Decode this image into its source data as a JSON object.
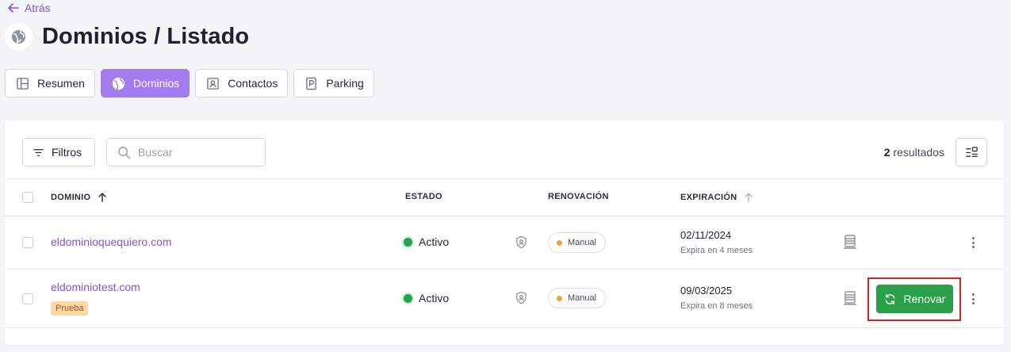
{
  "nav": {
    "back_label": "Atrás"
  },
  "header": {
    "title": "Dominios / Listado",
    "icon": "globe-icon"
  },
  "tabs": [
    {
      "label": "Resumen",
      "icon": "layout-icon",
      "active": false
    },
    {
      "label": "Dominios",
      "icon": "globe-icon",
      "active": true
    },
    {
      "label": "Contactos",
      "icon": "contact-card-icon",
      "active": false
    },
    {
      "label": "Parking",
      "icon": "parking-icon",
      "active": false
    }
  ],
  "toolbar": {
    "filters_label": "Filtros",
    "search_placeholder": "Buscar",
    "search_value": "",
    "results_count": "2",
    "results_label": "resultados"
  },
  "table": {
    "headers": {
      "dominio": "DOMINIO",
      "estado": "ESTADO",
      "renovacion": "RENOVACIÓN",
      "expiracion": "EXPIRACIÓN"
    },
    "rows": [
      {
        "domain": "eldominioquequiero.com",
        "badge": "",
        "status": "Activo",
        "renewal": "Manual",
        "expiration_date": "02/11/2024",
        "expiration_note": "Expira en 4 meses",
        "action_label": ""
      },
      {
        "domain": "eldominiotest.com",
        "badge": "Prueba",
        "status": "Activo",
        "renewal": "Manual",
        "expiration_date": "09/03/2025",
        "expiration_note": "Expira en 8 meses",
        "action_label": "Renovar"
      }
    ]
  },
  "colors": {
    "accent": "#8a4fe0",
    "active_tab": "#a37cf0",
    "status_active": "#22a44a",
    "renew_button": "#2ba04a",
    "highlight": "#d32424"
  }
}
